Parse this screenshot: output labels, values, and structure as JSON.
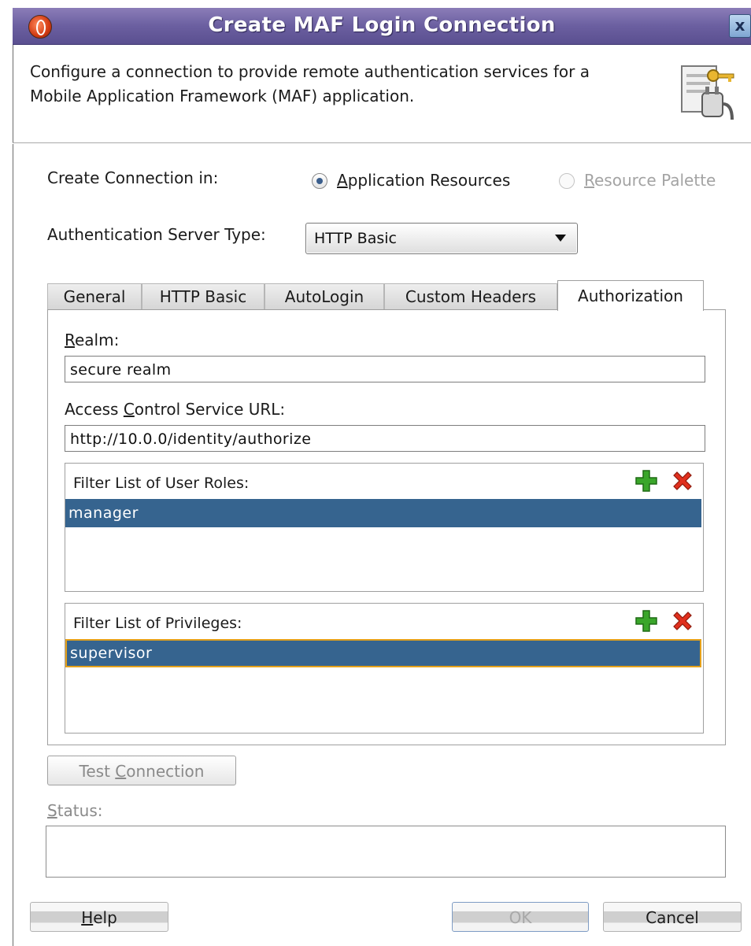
{
  "window": {
    "title": "Create MAF Login Connection",
    "close_symbol": "x"
  },
  "header": {
    "description_line1": "Configure a connection to provide remote authentication services for a",
    "description_line2": "Mobile Application Framework (MAF) application.",
    "icon": "connection-key-icon"
  },
  "create_in": {
    "label": "Create Connection in:",
    "options": [
      {
        "label": "Application Resources",
        "selected": true,
        "enabled": true
      },
      {
        "label": "Resource Palette",
        "selected": false,
        "enabled": false
      }
    ]
  },
  "auth_type": {
    "label": "Authentication Server Type:",
    "selected": "HTTP Basic"
  },
  "tabs": [
    {
      "label": "General",
      "active": false
    },
    {
      "label": "HTTP Basic",
      "active": false
    },
    {
      "label": "AutoLogin",
      "active": false
    },
    {
      "label": "Custom Headers",
      "active": false
    },
    {
      "label": "Authorization",
      "active": true
    }
  ],
  "authorization": {
    "realm_label": "Realm:",
    "realm_value": "secure realm",
    "acs_label": "Access Control Service URL:",
    "acs_value": "http://10.0.0/identity/authorize",
    "roles": {
      "label": "Filter List of User Roles:",
      "items": [
        "manager"
      ]
    },
    "privileges": {
      "label": "Filter List of Privileges:",
      "items": [
        "supervisor"
      ]
    }
  },
  "test_connection_label": "Test Connection",
  "status_label": "Status:",
  "buttons": {
    "help": "Help",
    "ok": "OK",
    "cancel": "Cancel"
  },
  "colors": {
    "title_bar": "#6b5fa0",
    "selection": "#36648f",
    "focus_border": "#e5a11a",
    "add_icon": "#3aa62a",
    "delete_icon": "#e0301e"
  }
}
